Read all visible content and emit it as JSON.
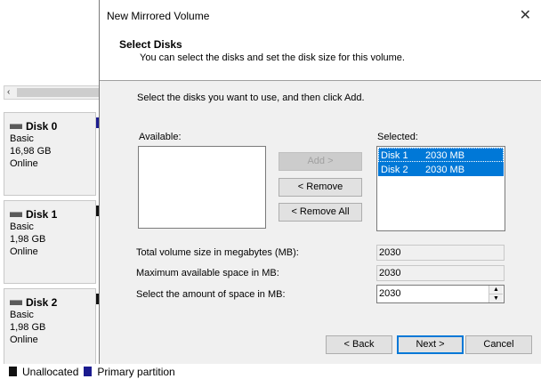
{
  "background": {
    "scroll_left": "‹",
    "disks": [
      {
        "name": "Disk 0",
        "type": "Basic",
        "size": "16,98 GB",
        "status": "Online"
      },
      {
        "name": "Disk 1",
        "type": "Basic",
        "size": "1,98 GB",
        "status": "Online"
      },
      {
        "name": "Disk 2",
        "type": "Basic",
        "size": "1,98 GB",
        "status": "Online"
      }
    ],
    "legend": {
      "unallocated": "Unallocated",
      "primary": "Primary partition"
    }
  },
  "dialog": {
    "title": "New Mirrored Volume",
    "close": "✕",
    "header_title": "Select Disks",
    "header_subtitle": "You can select the disks and set the disk size for this volume.",
    "instruction": "Select the disks you want to use, and then click Add.",
    "available_label": "Available:",
    "selected_label": "Selected:",
    "selected_items": [
      {
        "disk": "Disk 1",
        "size": "2030 MB"
      },
      {
        "disk": "Disk 2",
        "size": "2030 MB"
      }
    ],
    "buttons": {
      "add": "Add >",
      "remove": "< Remove",
      "remove_all": "< Remove All"
    },
    "total_label": "Total volume size in megabytes (MB):",
    "total_value": "2030",
    "max_label": "Maximum available space in MB:",
    "max_value": "2030",
    "amount_label": "Select the amount of space in MB:",
    "amount_value": "2030",
    "spin_up": "▲",
    "spin_down": "▼",
    "footer": {
      "back": "< Back",
      "next": "Next >",
      "cancel": "Cancel"
    }
  },
  "colors": {
    "selection": "#0078d7",
    "primary_partition": "#1b1b8f",
    "unallocated": "#111111"
  }
}
